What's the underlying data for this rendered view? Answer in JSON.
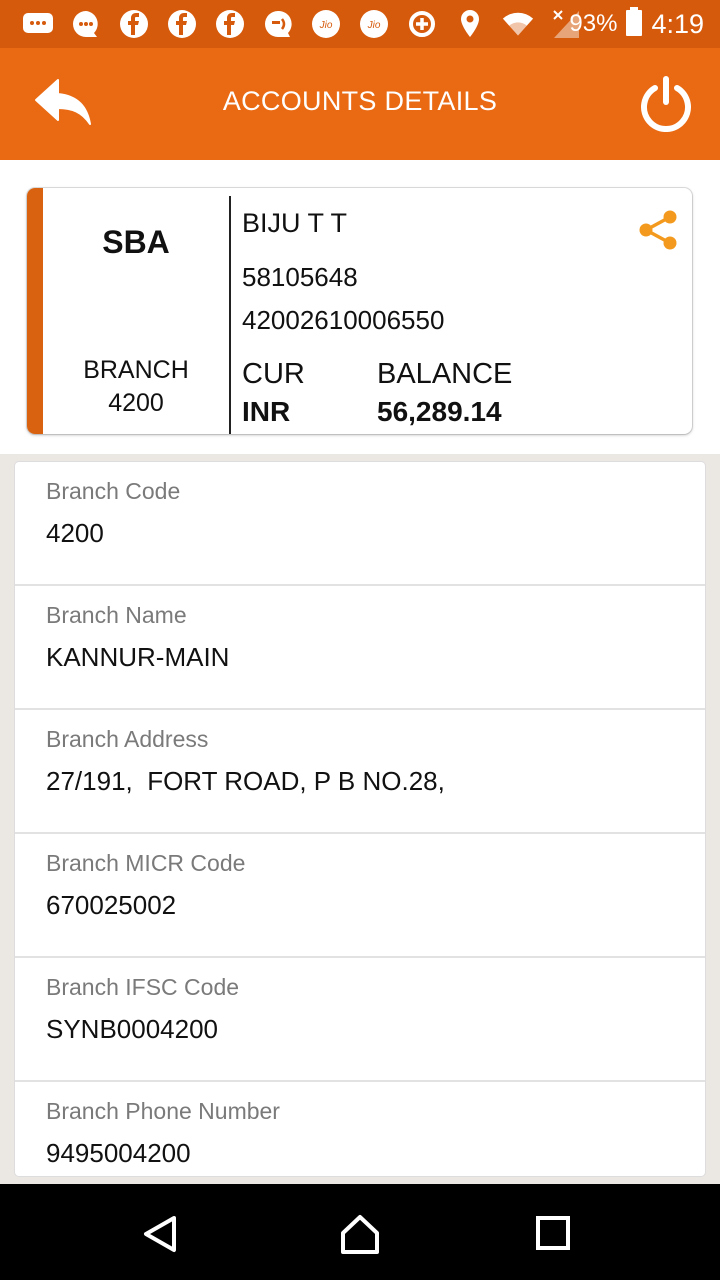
{
  "status_bar": {
    "icons": [
      "sms-icon",
      "messages-icon",
      "facebook-icon",
      "facebook-icon",
      "facebook-icon",
      "chat-icon",
      "jio-icon",
      "jio-icon",
      "data-saver-icon",
      "location-icon",
      "wifi-icon",
      "signal-icon"
    ],
    "battery": "93%",
    "time": "4:19"
  },
  "header": {
    "title": "ACCOUNTS DETAILS"
  },
  "account_card": {
    "type": "SBA",
    "branch_label": "BRANCH",
    "branch_code": "4200",
    "name": "BIJU T T",
    "customer_id": "58105648",
    "account_number": "42002610006550",
    "currency_label": "CUR",
    "currency": "INR",
    "balance_label": "BALANCE",
    "balance": "56,289.14"
  },
  "details": [
    {
      "label": "Branch Code",
      "value": "4200"
    },
    {
      "label": "Branch Name",
      "value": "KANNUR-MAIN"
    },
    {
      "label": "Branch Address",
      "value": "27/191,  FORT ROAD, P B NO.28,"
    },
    {
      "label": "Branch MICR Code",
      "value": "670025002"
    },
    {
      "label": "Branch IFSC Code",
      "value": "SYNB0004200"
    },
    {
      "label": "Branch Phone Number",
      "value": "9495004200"
    }
  ],
  "colors": {
    "primary": "#ea6a13",
    "status_bar": "#d65a0c",
    "accent_stripe": "#d8620f",
    "share_icon": "#f39a1e"
  }
}
